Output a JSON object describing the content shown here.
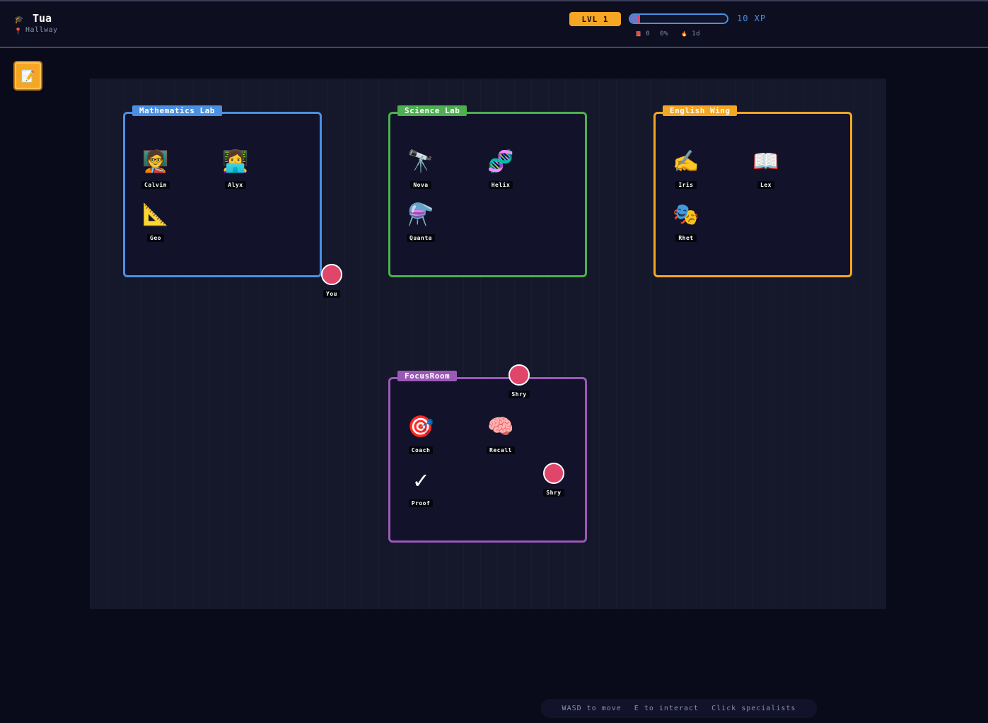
{
  "header": {
    "player_icon": "graduation-cap-icon",
    "player_icon_glyph": "🎓",
    "player_name": "Tua",
    "location_icon": "pin-icon",
    "location_icon_glyph": "📍",
    "location": "Hallway",
    "level_label": "LVL 1",
    "xp_progress": 0.1,
    "xp_label": "10 XP",
    "stats": [
      {
        "icon": "notebook-icon",
        "glyph": "📕",
        "value": "0"
      },
      {
        "icon": "",
        "glyph": "",
        "value": "0%"
      },
      {
        "icon": "flame-icon",
        "glyph": "🔥",
        "value": "1d"
      }
    ]
  },
  "menu_button": {
    "icon": "notes-icon",
    "glyph": "📝"
  },
  "colors": {
    "level_badge": "#f5a623",
    "math": "#4a90e2",
    "science": "#4caf50",
    "english": "#f5a623",
    "focus": "#9b59b6",
    "player": "#e0456a"
  },
  "rooms": [
    {
      "key": "math",
      "title": "Mathematics Lab",
      "npcs": [
        {
          "name": "Calvin",
          "icon": "teacher-icon",
          "emoji": "🧑‍🏫"
        },
        {
          "name": "Alyx",
          "icon": "technologist-icon",
          "emoji": "👩‍💻"
        },
        {
          "name": "Geo",
          "icon": "triangular-ruler-icon",
          "emoji": "📐"
        }
      ]
    },
    {
      "key": "science",
      "title": "Science Lab",
      "npcs": [
        {
          "name": "Nova",
          "icon": "telescope-icon",
          "emoji": "🔭"
        },
        {
          "name": "Helix",
          "icon": "dna-icon",
          "emoji": "🧬"
        },
        {
          "name": "Quanta",
          "icon": "flask-icon",
          "emoji": "⚗️"
        }
      ]
    },
    {
      "key": "english",
      "title": "English Wing",
      "npcs": [
        {
          "name": "Iris",
          "icon": "writing-hand-icon",
          "emoji": "✍️"
        },
        {
          "name": "Lex",
          "icon": "open-book-icon",
          "emoji": "📖"
        },
        {
          "name": "Rhet",
          "icon": "theater-masks-icon",
          "emoji": "🎭"
        }
      ]
    },
    {
      "key": "focus",
      "title": "FocusRoom",
      "npcs": [
        {
          "name": "Coach",
          "icon": "target-icon",
          "emoji": "🎯"
        },
        {
          "name": "Recall",
          "icon": "brain-icon",
          "emoji": "🧠"
        },
        {
          "name": "Proof",
          "icon": "check-mark-icon",
          "emoji": "✓"
        }
      ]
    }
  ],
  "players": [
    {
      "name": "You"
    },
    {
      "name": "Shry"
    },
    {
      "name": "Shry"
    }
  ],
  "controls_hint": [
    "WASD to move",
    "E to interact",
    "Click specialists"
  ]
}
